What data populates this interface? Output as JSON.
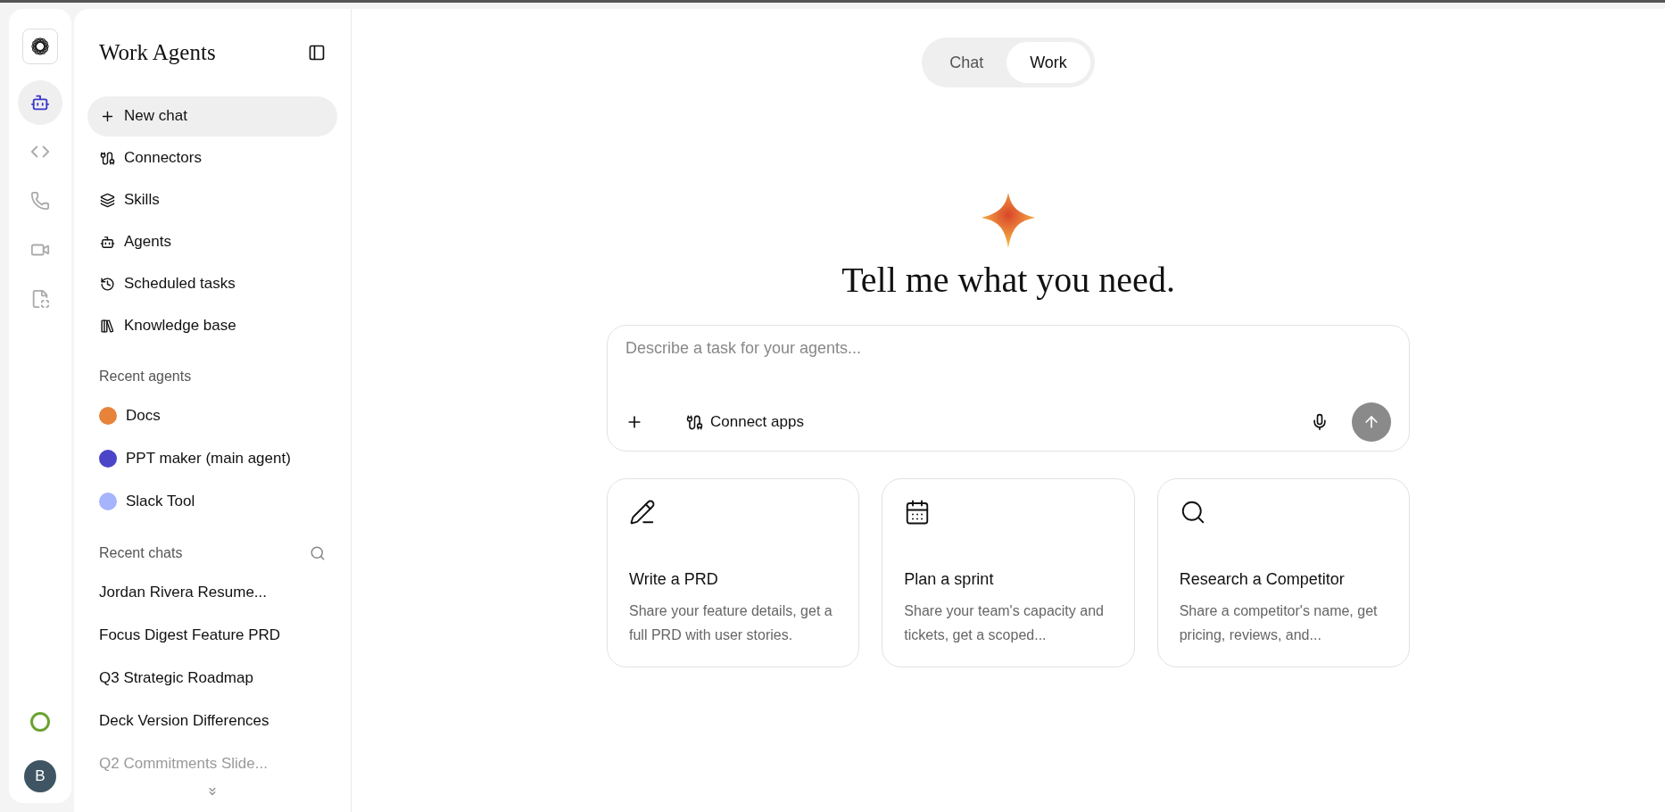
{
  "rail": {
    "items": [
      {
        "kind": "agents",
        "selected": true
      },
      {
        "kind": "code",
        "selected": false
      },
      {
        "kind": "phone",
        "selected": false
      },
      {
        "kind": "video",
        "selected": false
      },
      {
        "kind": "file",
        "selected": false
      }
    ],
    "avatar": "B"
  },
  "sidebar": {
    "title": "Work Agents",
    "nav": [
      {
        "kind": "new",
        "label": "New chat",
        "selected": true
      },
      {
        "kind": "connectors",
        "label": "Connectors",
        "selected": false
      },
      {
        "kind": "skills",
        "label": "Skills",
        "selected": false
      },
      {
        "kind": "agents",
        "label": "Agents",
        "selected": false
      },
      {
        "kind": "scheduled",
        "label": "Scheduled tasks",
        "selected": false
      },
      {
        "kind": "knowledge",
        "label": "Knowledge base",
        "selected": false
      }
    ],
    "recent_agents_heading": "Recent agents",
    "recent_agents": [
      {
        "label": "Docs",
        "color": "#e8833a"
      },
      {
        "label": "PPT maker (main agent)",
        "color": "#4b45c8"
      },
      {
        "label": "Slack Tool",
        "color": "#a5b4fc"
      }
    ],
    "recent_chats_heading": "Recent chats",
    "recent_chats": [
      {
        "label": "Jordan Rivera Resume...",
        "faded": false
      },
      {
        "label": "Focus Digest Feature PRD",
        "faded": false
      },
      {
        "label": "Q3 Strategic Roadmap",
        "faded": false
      },
      {
        "label": "Deck Version Differences",
        "faded": false
      },
      {
        "label": "Q2 Commitments Slide...",
        "faded": true
      }
    ]
  },
  "mode_tabs": [
    {
      "label": "Chat",
      "selected": false
    },
    {
      "label": "Work",
      "selected": true
    }
  ],
  "heading": "Tell me what you need.",
  "composer": {
    "placeholder": "Describe a task for your agents...",
    "connect_label": "Connect apps"
  },
  "cards": [
    {
      "kind": "write",
      "title": "Write a PRD",
      "description": "Share your feature details, get a full PRD with user stories."
    },
    {
      "kind": "plan",
      "title": "Plan a sprint",
      "description": "Share your team's capacity and tickets, get a scoped..."
    },
    {
      "kind": "research",
      "title": "Research a Competitor",
      "description": "Share a competitor's name, get pricing, reviews, and..."
    }
  ]
}
